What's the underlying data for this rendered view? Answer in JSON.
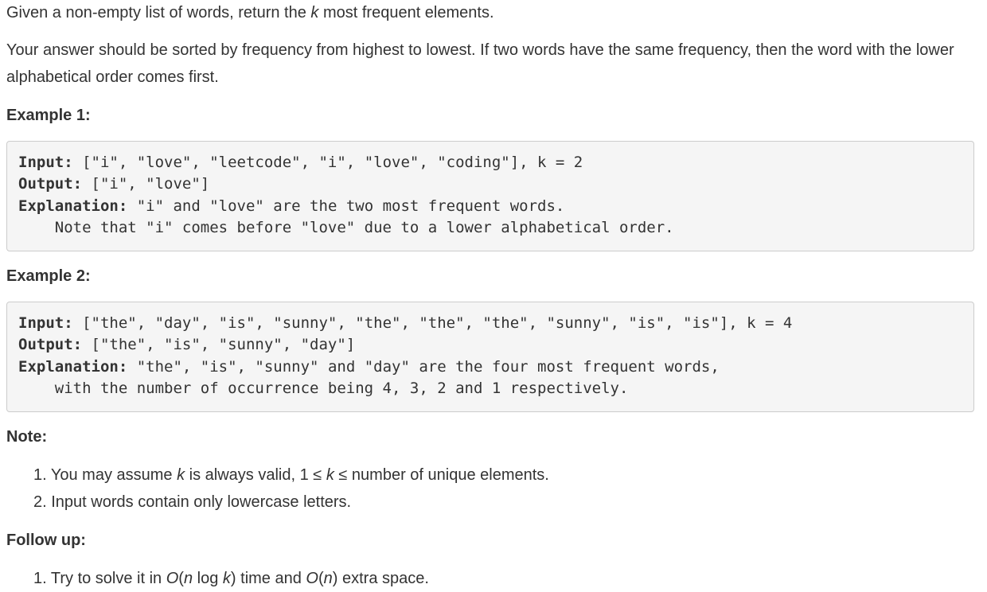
{
  "intro": {
    "before_k": "Given a non-empty list of words, return the ",
    "k": "k",
    "after_k": " most frequent elements."
  },
  "description": {
    "line1": "Your answer should be sorted by frequency from highest to lowest. If two words have the same frequency, then the word with the lower",
    "line2": "alphabetical order comes first."
  },
  "example1": {
    "heading": "Example 1:",
    "input_label": "Input:",
    "input_value": " [\"i\", \"love\", \"leetcode\", \"i\", \"love\", \"coding\"], k = 2",
    "output_label": "Output:",
    "output_value": " [\"i\", \"love\"]",
    "explanation_label": "Explanation:",
    "explanation_value": " \"i\" and \"love\" are the two most frequent words.",
    "explanation_cont": "    Note that \"i\" comes before \"love\" due to a lower alphabetical order."
  },
  "example2": {
    "heading": "Example 2:",
    "input_label": "Input:",
    "input_value": " [\"the\", \"day\", \"is\", \"sunny\", \"the\", \"the\", \"the\", \"sunny\", \"is\", \"is\"], k = 4",
    "output_label": "Output:",
    "output_value": " [\"the\", \"is\", \"sunny\", \"day\"]",
    "explanation_label": "Explanation:",
    "explanation_value": " \"the\", \"is\", \"sunny\" and \"day\" are the four most frequent words,",
    "explanation_cont": "    with the number of occurrence being 4, 3, 2 and 1 respectively."
  },
  "note": {
    "heading": "Note:",
    "item1": {
      "num": "1. ",
      "a": "You may assume ",
      "k1": "k",
      "b": " is always valid, 1 ≤ ",
      "k2": "k",
      "c": " ≤ number of unique elements."
    },
    "item2": {
      "num": "2. ",
      "text": "Input words contain only lowercase letters."
    }
  },
  "follow_up": {
    "heading": "Follow up:",
    "item1": {
      "num": "1. ",
      "a": "Try to solve it in ",
      "o1": "O",
      "p1": "(",
      "n1": "n",
      "log": " log ",
      "k": "k",
      "p2": ")",
      "b": " time and ",
      "o2": "O",
      "p3": "(",
      "n2": "n",
      "p4": ")",
      "c": " extra space."
    }
  }
}
